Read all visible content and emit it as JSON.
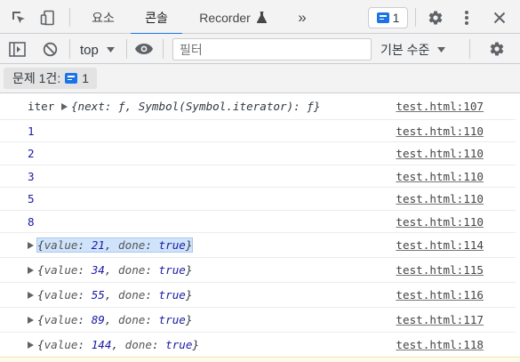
{
  "tabs": {
    "elements": "요소",
    "console": "콘솔",
    "recorder": "Recorder",
    "more": "»"
  },
  "issues_badge": {
    "count": "1"
  },
  "toolbar": {
    "context": "top",
    "filter_placeholder": "필터",
    "levels": "기본 수준"
  },
  "issues_bar": {
    "label": "문제 1건:",
    "count": "1"
  },
  "colors": {
    "accent": "#1a73e8",
    "number": "#1a1aa6",
    "selection": "#cfe3fb"
  },
  "rows": [
    {
      "label": "iter",
      "text": "{next: ƒ, Symbol(Symbol.iterator): ƒ}",
      "source": "test.html:107"
    },
    {
      "text": "1",
      "source": "test.html:110"
    },
    {
      "text": "2",
      "source": "test.html:110"
    },
    {
      "text": "3",
      "source": "test.html:110"
    },
    {
      "text": "5",
      "source": "test.html:110"
    },
    {
      "text": "8",
      "source": "test.html:110"
    },
    {
      "value": "21",
      "done": "true",
      "source": "test.html:114"
    },
    {
      "value": "34",
      "done": "true",
      "source": "test.html:115"
    },
    {
      "value": "55",
      "done": "true",
      "source": "test.html:116"
    },
    {
      "value": "89",
      "done": "true",
      "source": "test.html:117"
    },
    {
      "value": "144",
      "done": "true",
      "source": "test.html:118"
    }
  ],
  "obj_keys": {
    "value": "value",
    "done": "done"
  }
}
